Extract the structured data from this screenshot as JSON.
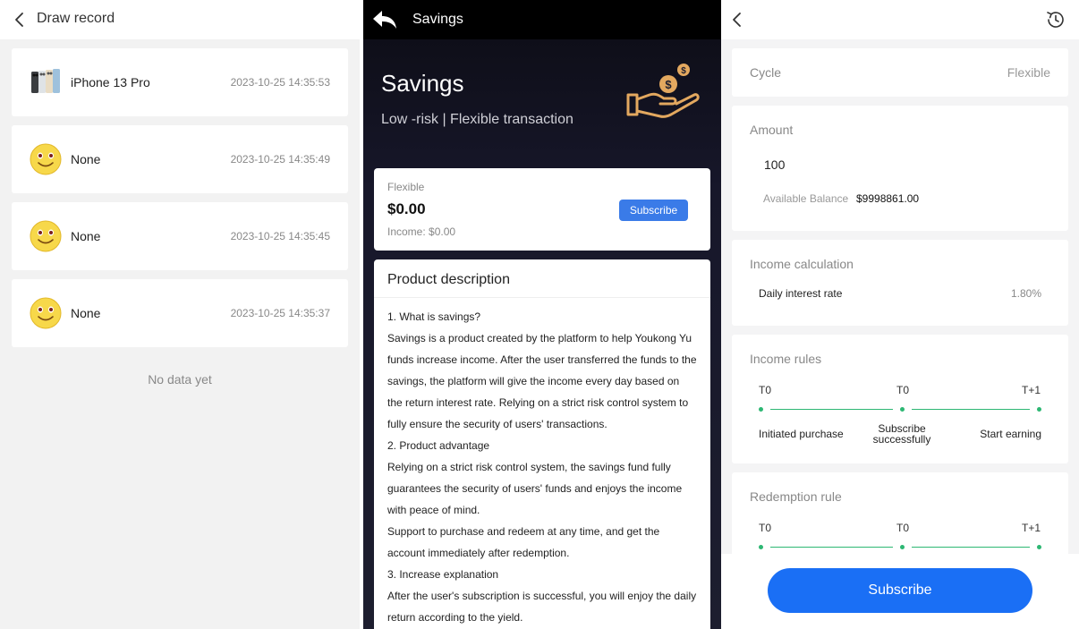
{
  "draw_record": {
    "title": "Draw record",
    "records": [
      {
        "name": "iPhone 13 Pro",
        "time": "2023-10-25 14:35:53"
      },
      {
        "name": "None",
        "time": "2023-10-25 14:35:49"
      },
      {
        "name": "None",
        "time": "2023-10-25 14:35:45"
      },
      {
        "name": "None",
        "time": "2023-10-25 14:35:37"
      }
    ],
    "empty_text": "No data yet"
  },
  "savings": {
    "header_title": "Savings",
    "hero_title": "Savings",
    "hero_subtitle": "Low -risk | Flexible transaction",
    "flex_card": {
      "label": "Flexible",
      "amount": "$0.00",
      "income": "Income: $0.00",
      "button": "Subscribe"
    },
    "description": {
      "title": "Product description",
      "lines": [
        "1. What is savings?",
        "Savings is a product created by the platform to help Youkong Yu",
        "funds increase income. After the user transferred the funds to the",
        "savings, the platform will give the income every day based on",
        "the return interest rate. Relying on a strict risk control system to",
        "fully ensure the security of users' transactions.",
        "2. Product advantage",
        "Relying on a strict risk control system, the savings fund fully",
        "guarantees the security of users' funds and enjoys the income",
        "with peace of mind.",
        "Support to purchase and redeem at any time, and get the",
        "account immediately after redemption.",
        "3. Increase explanation",
        "After the user's subscription is successful, you will enjoy the daily",
        "return according to the yield."
      ]
    }
  },
  "subscribe_form": {
    "cycle": {
      "label": "Cycle",
      "value": "Flexible"
    },
    "amount": {
      "label": "Amount",
      "value": "100",
      "balance_label": "Available Balance",
      "balance_value": "$9998861.00"
    },
    "income_calc": {
      "title": "Income calculation",
      "rate_label": "Daily interest rate",
      "rate_value": "1.80%"
    },
    "income_rules": {
      "title": "Income rules",
      "steps": [
        {
          "t": "T0",
          "label": "Initiated purchase"
        },
        {
          "t": "T0",
          "label_line1": "Subscribe",
          "label_line2": "successfully"
        },
        {
          "t": "T+1",
          "label": "Start earning"
        }
      ]
    },
    "redemption_rule": {
      "title": "Redemption rule",
      "steps": [
        {
          "t": "T0"
        },
        {
          "t": "T0"
        },
        {
          "t": "T+1"
        }
      ]
    },
    "subscribe_button": "Subscribe"
  },
  "colors": {
    "accent_blue": "#1a6ff5",
    "timeline_green": "#2db773",
    "hand_icon_gold": "#e3a85f"
  },
  "icons": [
    "chevron-left-icon",
    "back-arrow-icon",
    "hand-coin-icon",
    "clock-history-icon",
    "smiley-icon"
  ]
}
